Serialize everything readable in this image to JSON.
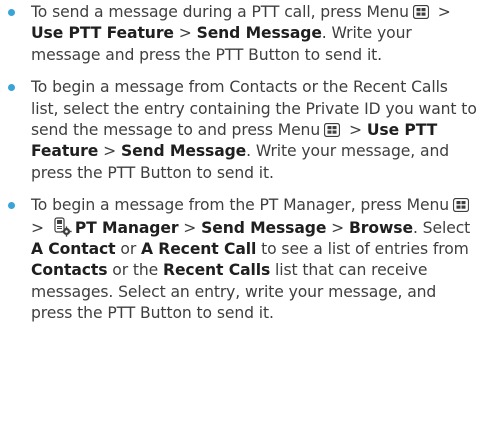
{
  "items": [
    {
      "before_menu": "To send a message during a PTT call, press Menu",
      "sep1": " > ",
      "use_ptt_feature": "Use PTT Feature",
      "sep2": " > ",
      "send_message": "Send Message",
      "after": ". Write your message and press the PTT Button to send it."
    },
    {
      "before_menu": "To begin a message from Contacts or the Recent Calls list, select the entry containing the Private ID you want to send the message to and press Menu",
      "sep1": " > ",
      "use_ptt_feature": "Use PTT Feature",
      "sep2": " > ",
      "send_message": "Send Message",
      "after": ". Write your message, and press the PTT Button to send it."
    },
    {
      "before_menu": "To begin a message from the PT Manager, press Menu",
      "sep1": " > ",
      "pt_manager": "PT Manager",
      "sep2": " > ",
      "send_message": "Send Message",
      "sep3": " > ",
      "browse": "Browse",
      "text1": ". Select ",
      "a_contact": "A Contact",
      "text2": " or ",
      "a_recent_call": "A Recent Call",
      "text3": " to see a list of entries from ",
      "contacts": "Contacts",
      "text4": " or the ",
      "recent_calls": "Recent Calls",
      "text5": " list that can receive messages. Select an entry, write your message, and press the PTT Button to send it."
    }
  ],
  "icons": {
    "menu_key": "menu-key-icon",
    "pt_manager": "pt-manager-icon"
  },
  "colors": {
    "bullet": "#3aa3d8",
    "text": "#3f3f3f"
  }
}
